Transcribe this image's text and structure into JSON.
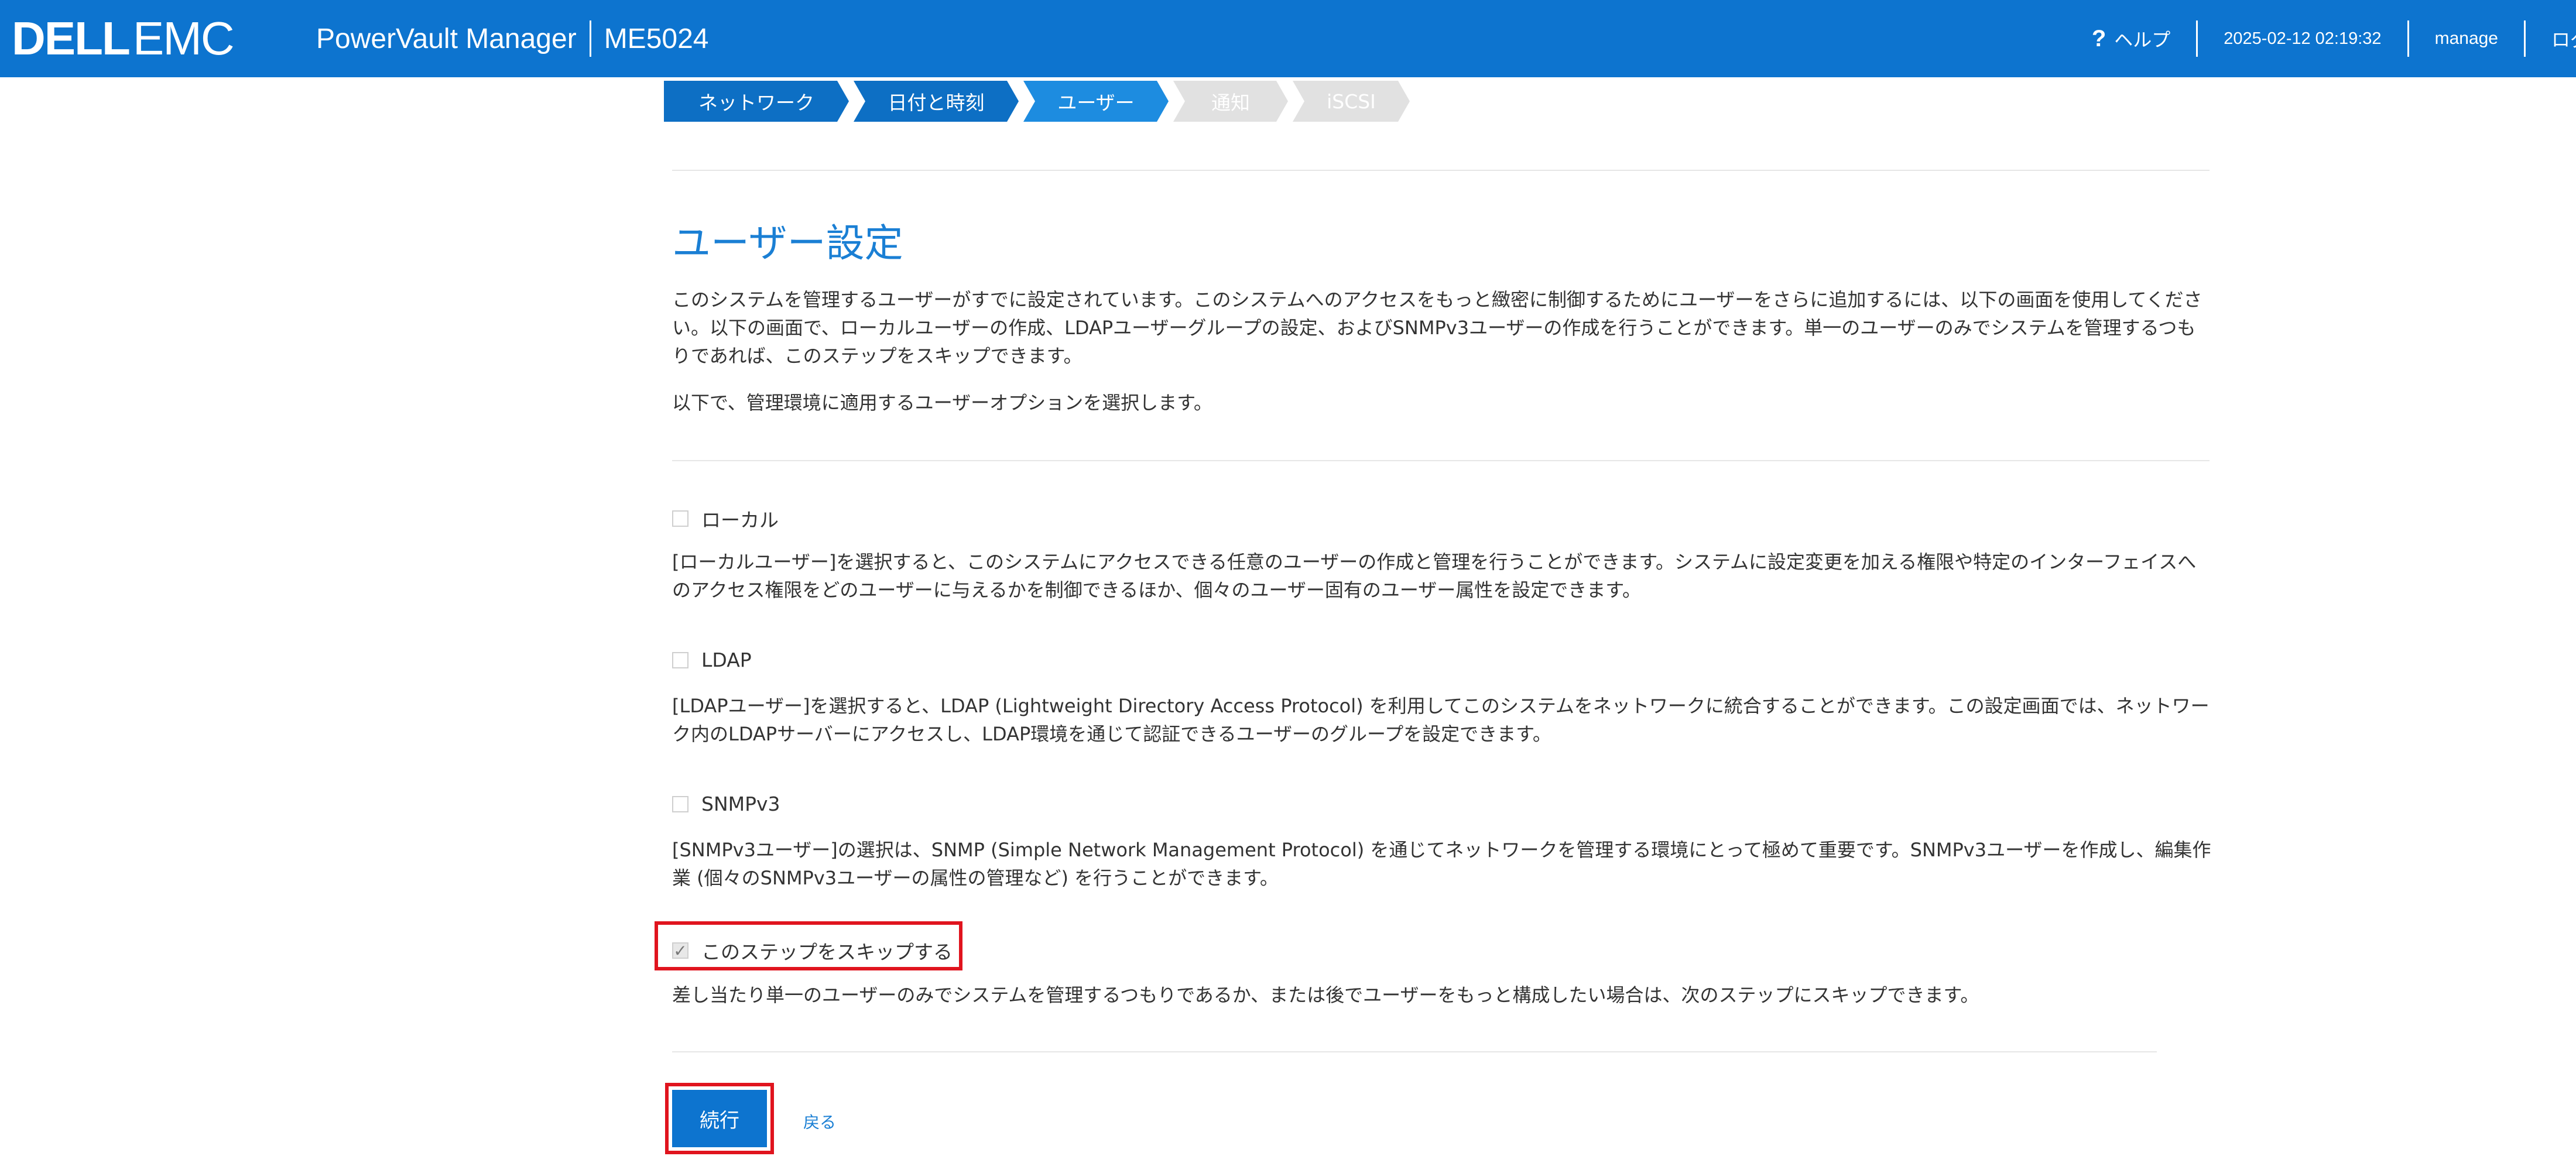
{
  "header": {
    "brand_dell": "DELL",
    "brand_emc": "EMC",
    "product": "PowerVault Manager",
    "model": "ME5024",
    "help_label": "ヘルプ",
    "datetime": "2025-02-12 02:19:32",
    "user": "manage",
    "logout_label": "ログアウト",
    "bg_color": "#0d74cf"
  },
  "steps": [
    {
      "label": "ネットワーク",
      "state": "done"
    },
    {
      "label": "日付と時刻",
      "state": "done"
    },
    {
      "label": "ユーザー",
      "state": "active"
    },
    {
      "label": "通知",
      "state": "todo"
    },
    {
      "label": "iSCSI",
      "state": "todo"
    }
  ],
  "main": {
    "title": "ユーザー設定",
    "intro": "このシステムを管理するユーザーがすでに設定されています。このシステムへのアクセスをもっと緻密に制御するためにユーザーをさらに追加するには、以下の画面を使用してください。以下の画面で、ローカルユーザーの作成、LDAPユーザーグループの設定、およびSNMPv3ユーザーの作成を行うことができます。単一のユーザーのみでシステムを管理するつもりであれば、このステップをスキップできます。",
    "select_prompt": "以下で、管理環境に適用するユーザーオプションを選択します。",
    "options": [
      {
        "label": "ローカル",
        "checked": false,
        "description": "[ローカルユーザー]を選択すると、このシステムにアクセスできる任意のユーザーの作成と管理を行うことができます。システムに設定変更を加える権限や特定のインターフェイスへのアクセス権限をどのユーザーに与えるかを制御できるほか、個々のユーザー固有のユーザー属性を設定できます。"
      },
      {
        "label": "LDAP",
        "checked": false,
        "description": "[LDAPユーザー]を選択すると、LDAP (Lightweight Directory Access Protocol) を利用してこのシステムをネットワークに統合することができます。この設定画面では、ネットワーク内のLDAPサーバーにアクセスし、LDAP環境を通じて認証できるユーザーのグループを設定できます。"
      },
      {
        "label": "SNMPv3",
        "checked": false,
        "description": "[SNMPv3ユーザー]の選択は、SNMP (Simple Network Management Protocol) を通じてネットワークを管理する環境にとって極めて重要です。SNMPv3ユーザーを作成し、編集作業 (個々のSNMPv3ユーザーの属性の管理など) を行うことができます。"
      }
    ],
    "skip": {
      "label": "このステップをスキップする",
      "checked": true,
      "description": "差し当たり単一のユーザーのみでシステムを管理するつもりであるか、または後でユーザーをもっと構成したい場合は、次のステップにスキップできます。"
    },
    "continue_label": "続行",
    "back_label": "戻る"
  }
}
